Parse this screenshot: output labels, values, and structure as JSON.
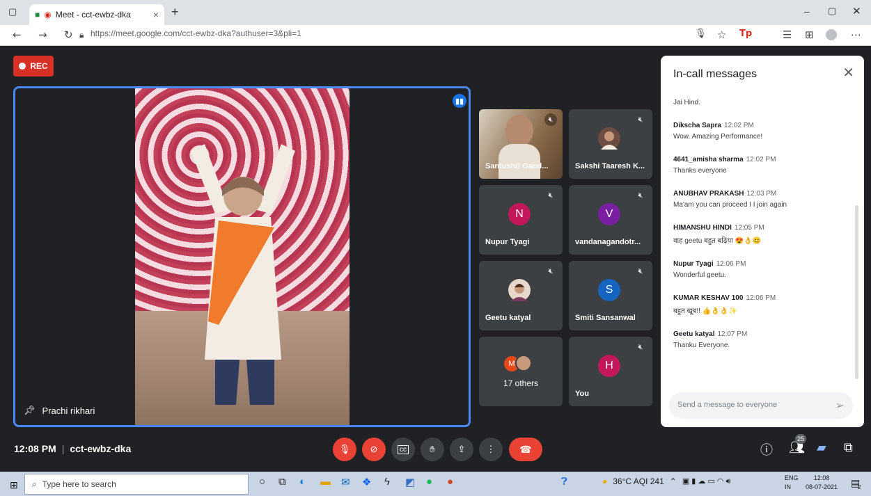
{
  "browser": {
    "tab_title": "Meet - cct-ewbz-dka",
    "tab_close": "×",
    "new_tab": "+",
    "url": "https://meet.google.com/cct-ewbz-dka?authuser=3&pli=1"
  },
  "recording": {
    "label": "REC"
  },
  "main_speaker": {
    "name": "Prachi rikhari"
  },
  "tiles": [
    {
      "name": "Santushti Gand...",
      "type": "video"
    },
    {
      "name": "Sakshi Taaresh K...",
      "type": "photo"
    },
    {
      "name": "Nupur Tyagi",
      "initial": "N",
      "color": "#c2185b"
    },
    {
      "name": "vandanagandotr...",
      "initial": "V",
      "color": "#7b1fa2"
    },
    {
      "name": "Geetu katyal",
      "type": "photo"
    },
    {
      "name": "Smiti Sansanwal",
      "initial": "S",
      "color": "#1565c0"
    },
    {
      "name": "17 others",
      "initial": "M",
      "color": "#e64a19"
    },
    {
      "name": "You",
      "initial": "H",
      "color": "#c2185b"
    }
  ],
  "chat": {
    "title": "In-call messages",
    "first_line": "Jai Hind.",
    "messages": [
      {
        "sender": "Dikscha Sapra",
        "time": "12:02 PM",
        "text": "Wow. Amazing Performance!"
      },
      {
        "sender": "4641_amisha sharma",
        "time": "12:02 PM",
        "text": "Thanks everyone"
      },
      {
        "sender": "ANUBHAV PRAKASH",
        "time": "12:03 PM",
        "text": "Ma'am you can proceed I I join again"
      },
      {
        "sender": "HIMANSHU HINDI",
        "time": "12:05 PM",
        "text": "वाह geetu बहुत बढ़िया 😍👌😊"
      },
      {
        "sender": "Nupur Tyagi",
        "time": "12:06 PM",
        "text": "Wonderful geetu."
      },
      {
        "sender": "KUMAR KESHAV 100",
        "time": "12:06 PM",
        "text": "बहुत खूब!! 👍👌👌✨"
      },
      {
        "sender": "Geetu katyal",
        "time": "12:07 PM",
        "text": "Thanku Everyone."
      }
    ],
    "placeholder": "Send a message to everyone"
  },
  "bottom": {
    "time": "12:08 PM",
    "separator": "|",
    "meeting_code": "cct-ewbz-dka",
    "participant_count": "25"
  },
  "taskbar": {
    "search_placeholder": "Type here to search",
    "weather": "36°C AQI 241",
    "lang_top": "ENG",
    "lang_bottom": "IN",
    "clock_time": "12:08",
    "clock_date": "08-07-2021",
    "notif_count": "2"
  }
}
